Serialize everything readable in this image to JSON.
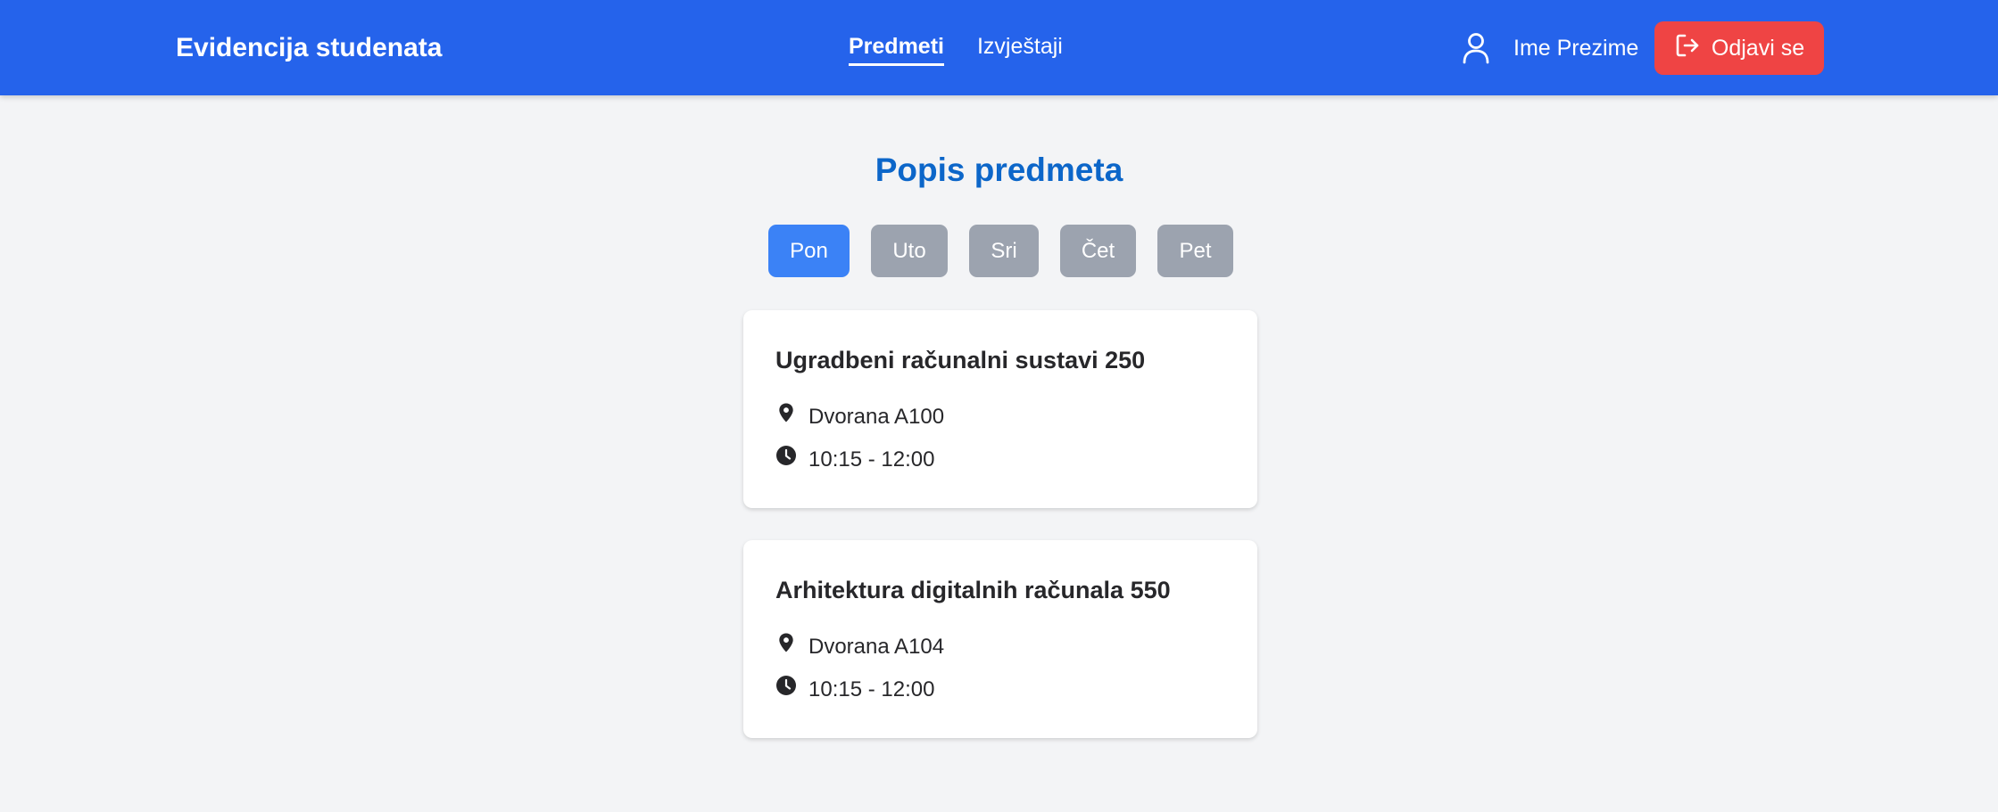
{
  "header": {
    "brand": "Evidencija studenata",
    "nav": [
      {
        "label": "Predmeti",
        "active": true
      },
      {
        "label": "Izvještaji",
        "active": false
      }
    ],
    "user_name": "Ime Prezime",
    "logout_label": "Odjavi se",
    "icons": {
      "user": "user-icon",
      "logout": "logout-icon"
    }
  },
  "main": {
    "title": "Popis predmeta",
    "days": [
      {
        "label": "Pon",
        "active": true
      },
      {
        "label": "Uto",
        "active": false
      },
      {
        "label": "Sri",
        "active": false
      },
      {
        "label": "Čet",
        "active": false
      },
      {
        "label": "Pet",
        "active": false
      }
    ],
    "subjects": [
      {
        "name": "Ugradbeni računalni sustavi 250",
        "room": "Dvorana A100",
        "time": "10:15 - 12:00"
      },
      {
        "name": "Arhitektura digitalnih računala 550",
        "room": "Dvorana A104",
        "time": "10:15 - 12:00"
      }
    ]
  },
  "colors": {
    "header_bg": "#2563eb",
    "logout_bg": "#ef4444",
    "title": "#0c66c9",
    "day_active": "#3b82f6",
    "day_inactive": "#9ca3af",
    "page_bg": "#f3f4f6"
  }
}
